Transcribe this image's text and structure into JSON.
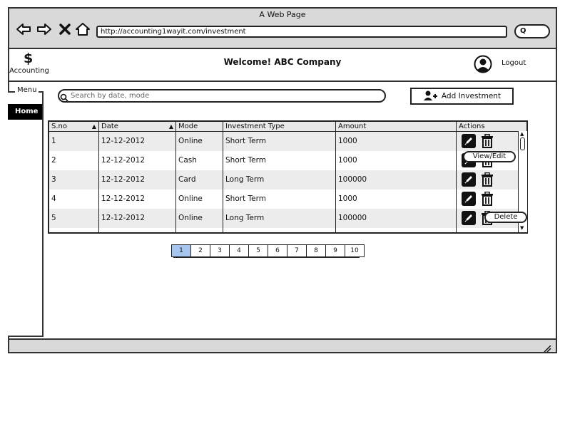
{
  "browser": {
    "title": "A Web Page",
    "url": "http://accounting1wayit.com/investment",
    "search_glyph": "Q"
  },
  "header": {
    "logo_symbol": "$",
    "logo_text": "Accounting",
    "welcome": "Welcome! ABC Company",
    "logout": "Logout"
  },
  "sidebar": {
    "menu_label": "Menu",
    "home_label": "Home"
  },
  "search": {
    "placeholder": "Search by date, mode"
  },
  "add_button": {
    "label": "Add Investment"
  },
  "table": {
    "columns": [
      "S.no",
      "Date",
      "Mode",
      "Investment Type",
      "Amount",
      "Actions"
    ],
    "rows": [
      [
        "1",
        "12-12-2012",
        "Online",
        "Short Term",
        "1000"
      ],
      [
        "2",
        "12-12-2012",
        "Cash",
        "Short Term",
        "1000"
      ],
      [
        "3",
        "12-12-2012",
        "Card",
        "Long Term",
        "100000"
      ],
      [
        "4",
        "12-12-2012",
        "Online",
        "Short Term",
        "1000"
      ],
      [
        "5",
        "12-12-2012",
        "Online",
        "Long Term",
        "100000"
      ]
    ],
    "tooltip_edit": "View/Edit",
    "tooltip_delete": "Delete"
  },
  "pagination": {
    "pages": [
      "1",
      "2",
      "3",
      "4",
      "5",
      "6",
      "7",
      "8",
      "9",
      "10"
    ],
    "active": "1"
  },
  "colors": {
    "active_page": "#a6c6ef",
    "chrome": "#d9d9d9"
  }
}
